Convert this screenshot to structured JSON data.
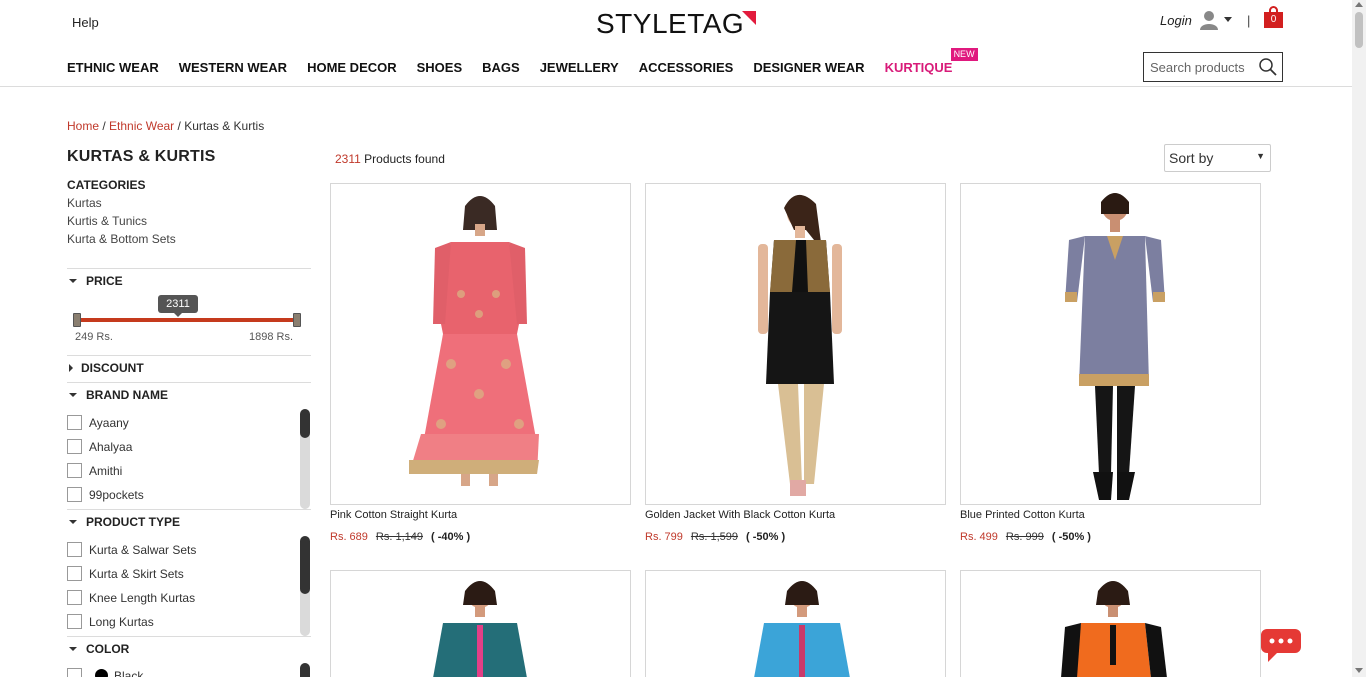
{
  "header": {
    "help": "Help",
    "logo": "STYLETAG",
    "login": "Login",
    "separator": "|",
    "cart_count": "0"
  },
  "nav": [
    {
      "label": "ETHNIC WEAR",
      "name": "nav-ethnic-wear"
    },
    {
      "label": "WESTERN WEAR",
      "name": "nav-western-wear"
    },
    {
      "label": "HOME DECOR",
      "name": "nav-home-decor"
    },
    {
      "label": "SHOES",
      "name": "nav-shoes"
    },
    {
      "label": "BAGS",
      "name": "nav-bags"
    },
    {
      "label": "JEWELLERY",
      "name": "nav-jewellery"
    },
    {
      "label": "ACCESSORIES",
      "name": "nav-accessories"
    },
    {
      "label": "DESIGNER WEAR",
      "name": "nav-designer-wear"
    },
    {
      "label": "KURTIQUE",
      "name": "nav-kurtique",
      "badge": "NEW"
    }
  ],
  "search": {
    "placeholder": "Search products"
  },
  "breadcrumb": {
    "home": "Home",
    "sep1": " / ",
    "ethnic": "Ethnic Wear",
    "sep2": " / ",
    "current": "Kurtas & Kurtis"
  },
  "sidebar": {
    "title": "KURTAS & KURTIS",
    "categories_heading": "CATEGORIES",
    "categories": [
      "Kurtas",
      "Kurtis & Tunics",
      "Kurta & Bottom Sets"
    ],
    "price": {
      "heading": "PRICE",
      "tooltip": "2311",
      "min_label": "249 Rs.",
      "max_label": "1898 Rs."
    },
    "discount_heading": "DISCOUNT",
    "brand": {
      "heading": "BRAND NAME",
      "items": [
        "Ayaany",
        "Ahalyaa",
        "Amithi",
        "99pockets"
      ]
    },
    "product_type": {
      "heading": "PRODUCT TYPE",
      "items": [
        "Kurta & Salwar Sets",
        "Kurta & Skirt Sets",
        "Knee Length Kurtas",
        "Long Kurtas"
      ]
    },
    "color": {
      "heading": "COLOR",
      "items": [
        "Black"
      ]
    }
  },
  "results": {
    "count": "2311",
    "count_suffix": " Products found",
    "sort_label": "Sort by",
    "sort_arrow": "▼"
  },
  "products": [
    {
      "name": "Pink Cotton Straight Kurta",
      "price": "Rs. 689",
      "mrp": "Rs. 1,149",
      "discount": "( -40% )"
    },
    {
      "name": "Golden Jacket With Black Cotton Kurta",
      "price": "Rs. 799",
      "mrp": "Rs. 1,599",
      "discount": "( -50% )"
    },
    {
      "name": "Blue Printed Cotton Kurta",
      "price": "Rs. 499",
      "mrp": "Rs. 999",
      "discount": "( -50% )"
    }
  ],
  "colors": {
    "accent_red": "#c0392b",
    "kurtique_pink": "#d81b79",
    "chat_red": "#e53935"
  }
}
